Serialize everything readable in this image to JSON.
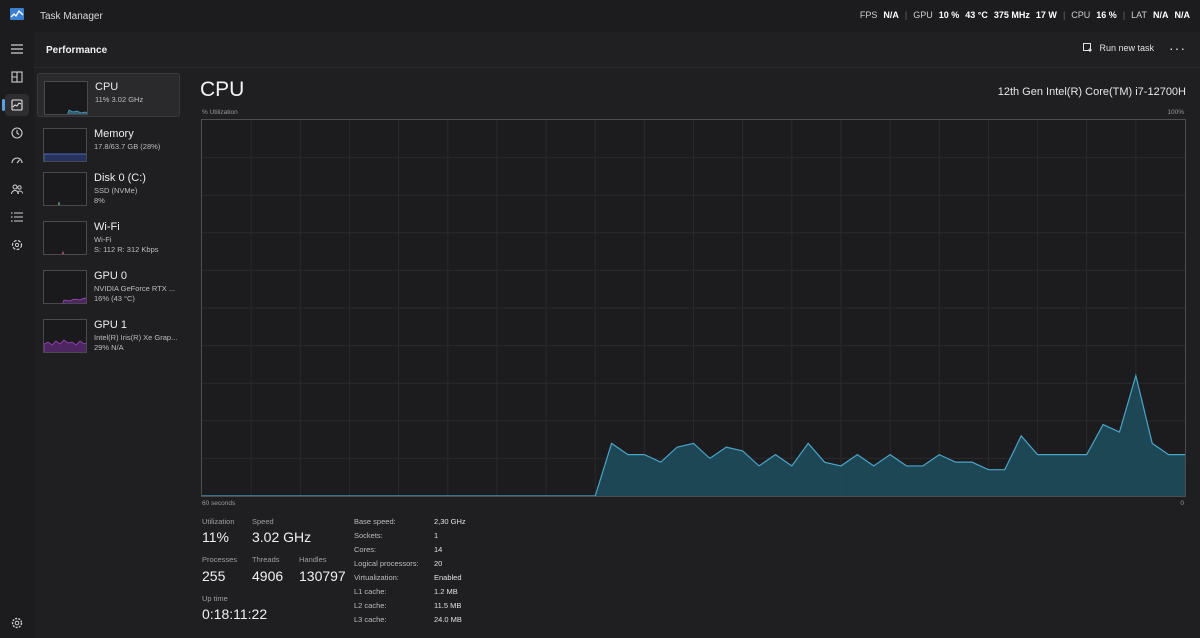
{
  "app": {
    "title": "Task Manager"
  },
  "overlay": {
    "fps_label": "FPS",
    "fps_value": "N/A",
    "gpu_label": "GPU",
    "gpu_util": "10 %",
    "gpu_temp": "43 °C",
    "gpu_clock": "375 MHz",
    "gpu_power": "17 W",
    "cpu_label": "CPU",
    "cpu_util": "16 %",
    "lat_label": "LAT",
    "lat_value": "N/A",
    "extra_value": "N/A"
  },
  "nav": {
    "items": [
      "menu-icon",
      "processes-icon",
      "performance-icon",
      "app-history-icon",
      "startup-apps-icon",
      "users-icon",
      "details-icon",
      "services-icon",
      "settings-icon"
    ]
  },
  "header": {
    "title": "Performance",
    "run_task_label": "Run new task",
    "more_label": "···"
  },
  "sidelist": {
    "items": [
      {
        "name": "CPU",
        "sub1": "11%  3.02 GHz",
        "sub2": ""
      },
      {
        "name": "Memory",
        "sub1": "17.8/63.7 GB (28%)",
        "sub2": ""
      },
      {
        "name": "Disk 0 (C:)",
        "sub1": "SSD (NVMe)",
        "sub2": "8%"
      },
      {
        "name": "Wi-Fi",
        "sub1": "Wi-Fi",
        "sub2": "S: 112  R: 312 Kbps"
      },
      {
        "name": "GPU 0",
        "sub1": "NVIDIA GeForce RTX ...",
        "sub2": "16%  (43 °C)"
      },
      {
        "name": "GPU 1",
        "sub1": "Intel(R) Iris(R) Xe Grap...",
        "sub2": "29%  N/A"
      }
    ],
    "colors": {
      "cpu": "#4aa3c9",
      "memory": "#5b7fd6",
      "disk": "#6fb46a",
      "wifi": "#c7577a",
      "gpu": "#a64bc9"
    }
  },
  "main": {
    "title": "CPU",
    "model": "12th Gen Intel(R) Core(TM) i7-12700H",
    "util_label": "% Utilization",
    "max_label": "100%",
    "seconds_label": "60 seconds",
    "zero_label": "0",
    "stats": {
      "utilization_label": "Utilization",
      "utilization_value": "11%",
      "speed_label": "Speed",
      "speed_value": "3.02 GHz",
      "processes_label": "Processes",
      "processes_value": "255",
      "threads_label": "Threads",
      "threads_value": "4906",
      "handles_label": "Handles",
      "handles_value": "130797",
      "uptime_label": "Up time",
      "uptime_value": "0:18:11:22"
    },
    "details": [
      {
        "key": "Base speed:",
        "value": "2,30 GHz"
      },
      {
        "key": "Sockets:",
        "value": "1"
      },
      {
        "key": "Cores:",
        "value": "14"
      },
      {
        "key": "Logical processors:",
        "value": "20"
      },
      {
        "key": "Virtualization:",
        "value": "Enabled"
      },
      {
        "key": "L1 cache:",
        "value": "1.2 MB"
      },
      {
        "key": "L2 cache:",
        "value": "11.5 MB"
      },
      {
        "key": "L3 cache:",
        "value": "24.0 MB"
      }
    ]
  },
  "chart_data": {
    "type": "area",
    "xlabel": "60 seconds",
    "ylabel": "% Utilization",
    "xlim": [
      60,
      0
    ],
    "ylim": [
      0,
      100
    ],
    "grid": true,
    "color": "#4aa3c9",
    "x": [
      60,
      36,
      35,
      34,
      33,
      32,
      31,
      30,
      29,
      28,
      27,
      26,
      25,
      24,
      23,
      22,
      21,
      20,
      19,
      18,
      17,
      16,
      15,
      14,
      13,
      12,
      11,
      10,
      9,
      8,
      7,
      6,
      5,
      4,
      3,
      2,
      1,
      0
    ],
    "series": [
      {
        "values": [
          0,
          0,
          14,
          11,
          11,
          9,
          13,
          14,
          10,
          13,
          12,
          8,
          11,
          8,
          14,
          9,
          8,
          11,
          8,
          11,
          8,
          8,
          11,
          9,
          9,
          7,
          7,
          16,
          11,
          11,
          11,
          11,
          19,
          17,
          32,
          14,
          11,
          11
        ]
      }
    ]
  }
}
